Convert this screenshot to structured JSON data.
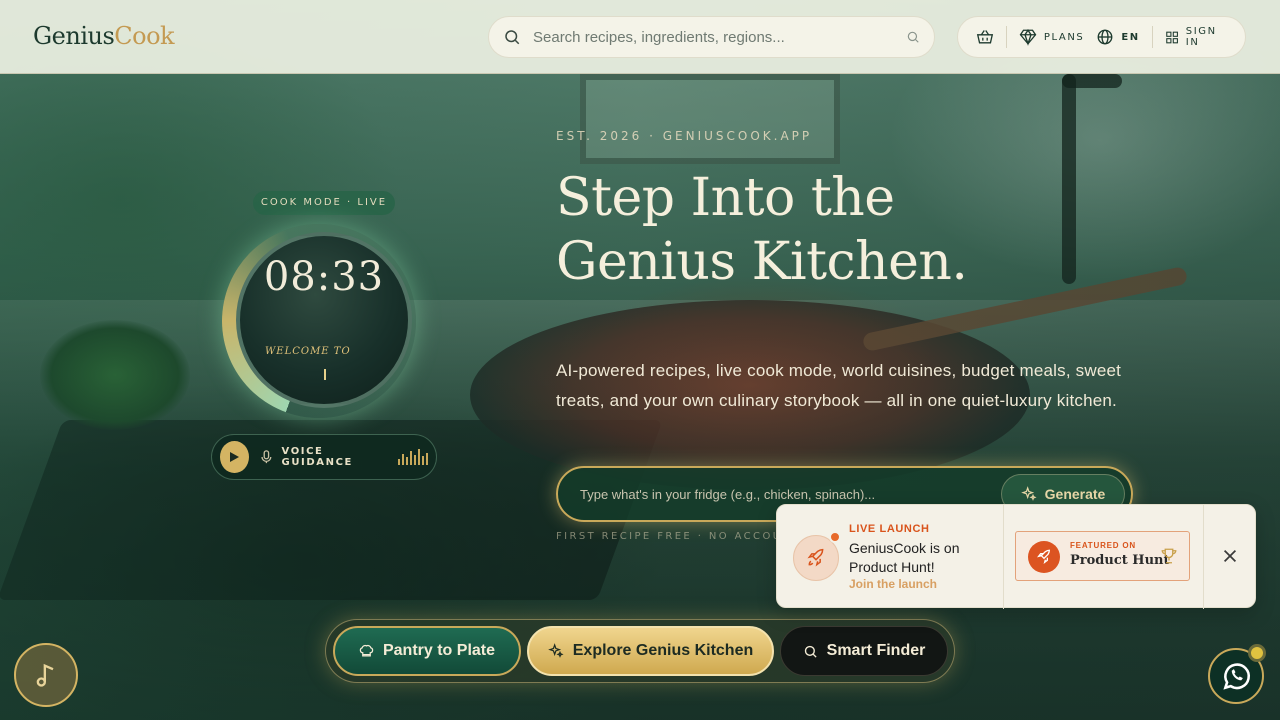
{
  "header": {
    "logo_part1": "Genius",
    "logo_part2": "Cook",
    "search_placeholder": "Search recipes, ingredients, regions...",
    "nav": {
      "plans": "PLANS",
      "language": "EN",
      "sign_in": "SIGN IN"
    }
  },
  "hero": {
    "eyebrow": "EST. 2026 · GENIUSCOOK.APP",
    "title_line1": "Step Into the",
    "title_line2": "Genius Kitchen.",
    "description": "AI-powered recipes, live cook mode, world cuisines, budget meals, sweet treats, and your own culinary storybook — all in one quiet-luxury kitchen.",
    "generator_placeholder": "Type what's in your fridge (e.g., chicken, spinach)...",
    "generate_label": "Generate",
    "footnote": "FIRST RECIPE FREE · NO ACCOUN"
  },
  "cook_widget": {
    "badge": "COOK MODE · LIVE",
    "time": "08:33",
    "welcome": "WELCOME TO",
    "voice_label": "VOICE GUIDANCE"
  },
  "ctas": {
    "pantry": "Pantry to Plate",
    "explore": "Explore Genius Kitchen",
    "finder": "Smart Finder"
  },
  "toast": {
    "live": "LIVE LAUNCH",
    "message": "GeniusCook is on Product Hunt!",
    "join": "Join the launch",
    "featured_small": "FEATURED ON",
    "featured_big": "Product Hunt"
  },
  "colors": {
    "accent_gold": "#c9a95a",
    "deep_green": "#124a38",
    "product_hunt_orange": "#dc5421"
  },
  "icons": {
    "search": "search-icon",
    "basket": "basket-icon",
    "diamond": "diamond-icon",
    "globe": "globe-icon",
    "grid": "grid-icon",
    "sparkles": "sparkles-icon",
    "play": "play-icon",
    "mic": "mic-icon",
    "chef_hat": "chef-hat-icon",
    "rocket": "rocket-icon",
    "trophy": "trophy-icon",
    "close": "close-icon",
    "music": "music-note-icon",
    "whatsapp": "whatsapp-icon"
  }
}
